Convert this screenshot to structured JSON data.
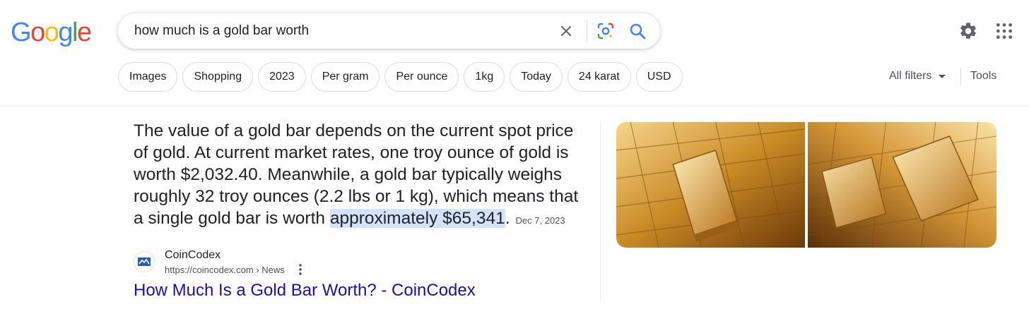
{
  "logo": {
    "text": "Google"
  },
  "search": {
    "query": "how much is a gold bar worth"
  },
  "chips": [
    "Images",
    "Shopping",
    "2023",
    "Per gram",
    "Per ounce",
    "1kg",
    "Today",
    "24 karat",
    "USD"
  ],
  "filters": {
    "all_filters": "All filters",
    "tools": "Tools"
  },
  "answer": {
    "text": "The value of a gold bar depends on the current spot price of gold. At current market rates, one troy ounce of gold is worth $2,032.40. Meanwhile, a gold bar typically weighs roughly 32 troy ounces (2.2 lbs or 1 kg), which means that a single gold bar is worth ",
    "highlight": "approximately $65,341",
    "end": ".",
    "date": "Dec 7, 2023"
  },
  "source": {
    "name": "CoinCodex",
    "url": "https://coincodex.com › News",
    "title": "How Much Is a Gold Bar Worth? - CoinCodex"
  },
  "colors": {
    "accent_blue": "#1a73e8",
    "link": "#1a0dab",
    "highlight": "#d3e3fd"
  },
  "icons": [
    "clear-icon",
    "google-lens-icon",
    "search-icon",
    "settings-gear-icon",
    "apps-grid-icon",
    "more-vert-icon"
  ]
}
